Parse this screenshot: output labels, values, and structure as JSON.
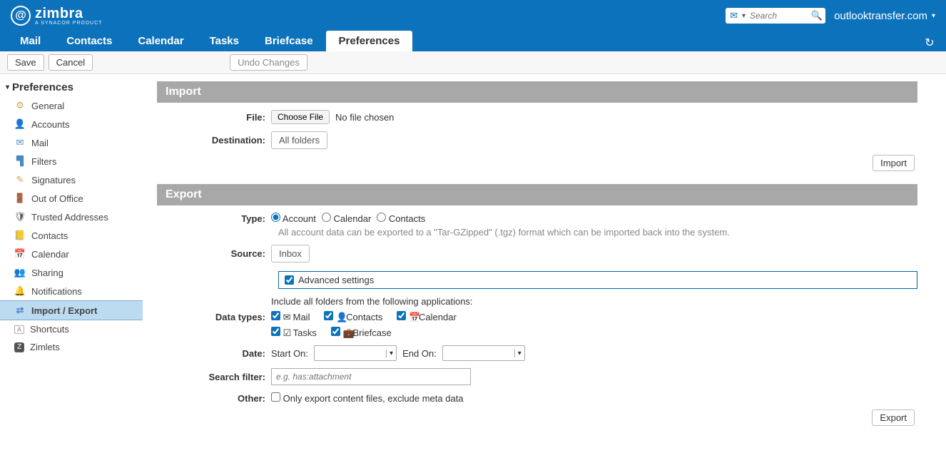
{
  "header": {
    "brand": "zimbra",
    "brand_sub": "A SYNACOR PRODUCT",
    "search_placeholder": "Search",
    "account": "outlooktransfer.com"
  },
  "tabs": {
    "mail": "Mail",
    "contacts": "Contacts",
    "calendar": "Calendar",
    "tasks": "Tasks",
    "briefcase": "Briefcase",
    "preferences": "Preferences"
  },
  "toolbar": {
    "save": "Save",
    "cancel": "Cancel",
    "undo": "Undo Changes"
  },
  "sidebar": {
    "title": "Preferences",
    "items": [
      {
        "label": "General"
      },
      {
        "label": "Accounts"
      },
      {
        "label": "Mail"
      },
      {
        "label": "Filters"
      },
      {
        "label": "Signatures"
      },
      {
        "label": "Out of Office"
      },
      {
        "label": "Trusted Addresses"
      },
      {
        "label": "Contacts"
      },
      {
        "label": "Calendar"
      },
      {
        "label": "Sharing"
      },
      {
        "label": "Notifications"
      },
      {
        "label": "Import / Export"
      },
      {
        "label": "Shortcuts"
      },
      {
        "label": "Zimlets"
      }
    ]
  },
  "import": {
    "title": "Import",
    "file_label": "File:",
    "choose": "Choose File",
    "nofile": "No file chosen",
    "dest_label": "Destination:",
    "dest_value": "All folders",
    "button": "Import"
  },
  "export": {
    "title": "Export",
    "type_label": "Type:",
    "type_account": "Account",
    "type_calendar": "Calendar",
    "type_contacts": "Contacts",
    "type_hint": "All account data can be exported to a \"Tar-GZipped\" (.tgz) format which can be imported back into the system.",
    "source_label": "Source:",
    "source_value": "Inbox",
    "adv": "Advanced settings",
    "datatypes_label": "Data types:",
    "datatypes_hint": "Include all folders from the following applications:",
    "dt_mail": "Mail",
    "dt_contacts": "Contacts",
    "dt_calendar": "Calendar",
    "dt_tasks": "Tasks",
    "dt_briefcase": "Briefcase",
    "date_label": "Date:",
    "start_on": "Start On:",
    "end_on": "End On:",
    "search_label": "Search filter:",
    "search_placeholder": "e.g. has:attachment",
    "other_label": "Other:",
    "other_opt": "Only export content files, exclude meta data",
    "button": "Export"
  }
}
